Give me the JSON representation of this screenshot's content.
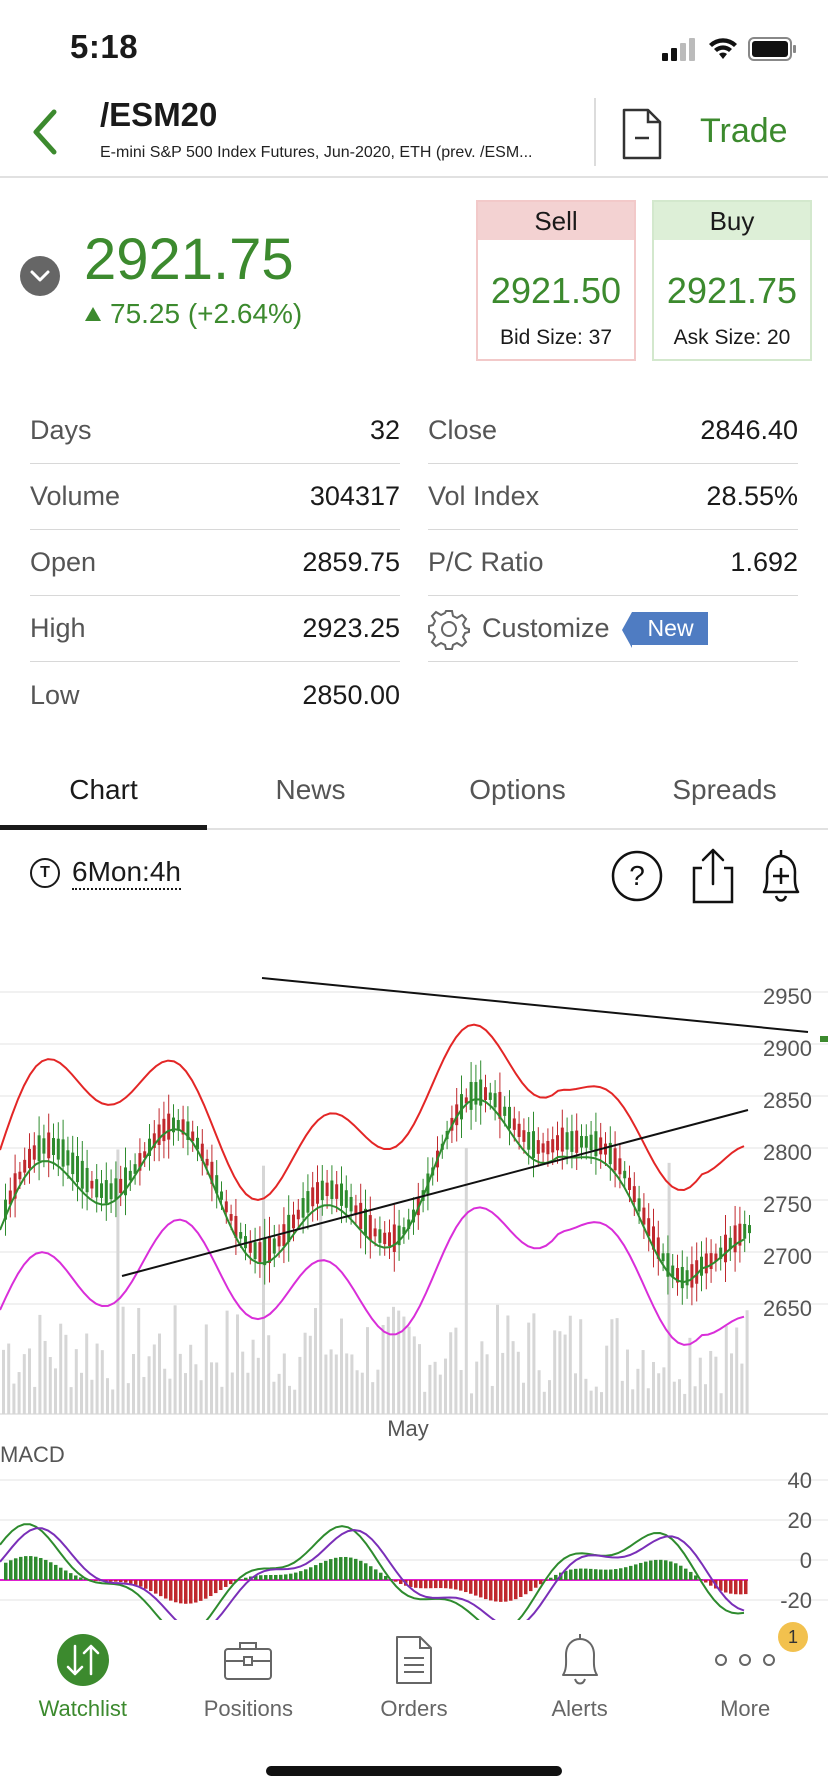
{
  "status": {
    "time": "5:18"
  },
  "header": {
    "symbol": "/ESM20",
    "description": "E-mini S&P 500 Index Futures, Jun-2020, ETH (prev. /ESM...",
    "trade_label": "Trade"
  },
  "quote": {
    "last": "2921.75",
    "change": "75.25 (+2.64%)",
    "sell": {
      "label": "Sell",
      "price": "2921.50",
      "size": "Bid Size: 37"
    },
    "buy": {
      "label": "Buy",
      "price": "2921.75",
      "size": "Ask Size: 20"
    }
  },
  "stats": {
    "left": [
      {
        "label": "Days",
        "value": "32"
      },
      {
        "label": "Volume",
        "value": "304317"
      },
      {
        "label": "Open",
        "value": "2859.75"
      },
      {
        "label": "High",
        "value": "2923.25"
      },
      {
        "label": "Low",
        "value": "2850.00"
      }
    ],
    "right": [
      {
        "label": "Close",
        "value": "2846.40"
      },
      {
        "label": "Vol Index",
        "value": "28.55%"
      },
      {
        "label": "P/C Ratio",
        "value": "1.692"
      }
    ],
    "customize_label": "Customize",
    "new_badge": "New"
  },
  "tabs": [
    "Chart",
    "News",
    "Options",
    "Spreads"
  ],
  "chart_toolbar": {
    "timeframe_icon": "T",
    "timeframe": "6Mon:4h"
  },
  "chart": {
    "price_ticks": [
      "2950",
      "2900",
      "2850",
      "2800",
      "2750",
      "2700",
      "2650"
    ],
    "month_label": "May",
    "macd_label": "MACD",
    "macd_ticks": [
      "40",
      "20",
      "0",
      "-20"
    ]
  },
  "colors": {
    "accent_green": "#3c8a2e",
    "down_red": "#c0282d",
    "bollinger_upper": "#e32626",
    "moving_average": "#2e8b2e",
    "bollinger_lower": "#d92ed9",
    "volume_gray": "#d6d6d6",
    "new_badge_blue": "#4f7cc2"
  },
  "tabbar": {
    "items": [
      {
        "label": "Watchlist",
        "icon": "watchlist-arrows-icon"
      },
      {
        "label": "Positions",
        "icon": "briefcase-icon"
      },
      {
        "label": "Orders",
        "icon": "document-icon"
      },
      {
        "label": "Alerts",
        "icon": "bell-icon"
      },
      {
        "label": "More",
        "icon": "more-dots-icon"
      }
    ],
    "more_badge": "1"
  }
}
